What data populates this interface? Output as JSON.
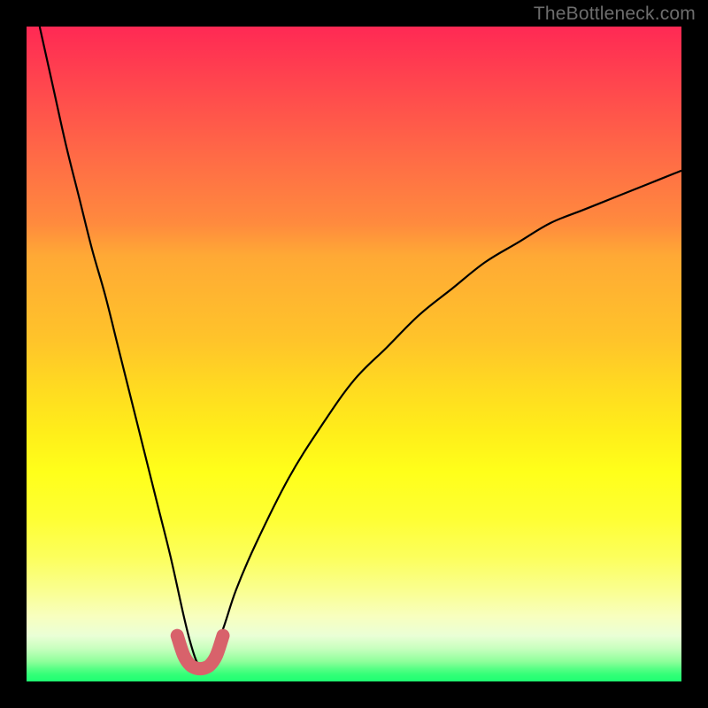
{
  "watermark": "TheBottleneck.com",
  "chart_data": {
    "type": "line",
    "title": "",
    "xlabel": "",
    "ylabel": "",
    "xlim": [
      0,
      100
    ],
    "ylim": [
      0,
      100
    ],
    "grid": false,
    "legend": false,
    "series": [
      {
        "name": "black-curve",
        "color": "#000000",
        "x": [
          2,
          4,
          6,
          8,
          10,
          12,
          14,
          16,
          18,
          20,
          22,
          24,
          25,
          26,
          27,
          28,
          30,
          32,
          35,
          40,
          45,
          50,
          55,
          60,
          65,
          70,
          75,
          80,
          85,
          90,
          95,
          100
        ],
        "y": [
          100,
          91,
          82,
          74,
          66,
          59,
          51,
          43,
          35,
          27,
          19,
          10,
          6,
          3,
          2,
          3,
          8,
          14,
          21,
          31,
          39,
          46,
          51,
          56,
          60,
          64,
          67,
          70,
          72,
          74,
          76,
          78
        ]
      },
      {
        "name": "red-dip-highlight",
        "color": "#d8626b",
        "x": [
          23,
          24,
          25,
          26,
          27,
          28,
          29,
          30
        ],
        "y": [
          7,
          4,
          2.5,
          2,
          2,
          2.5,
          4,
          7
        ]
      }
    ]
  }
}
